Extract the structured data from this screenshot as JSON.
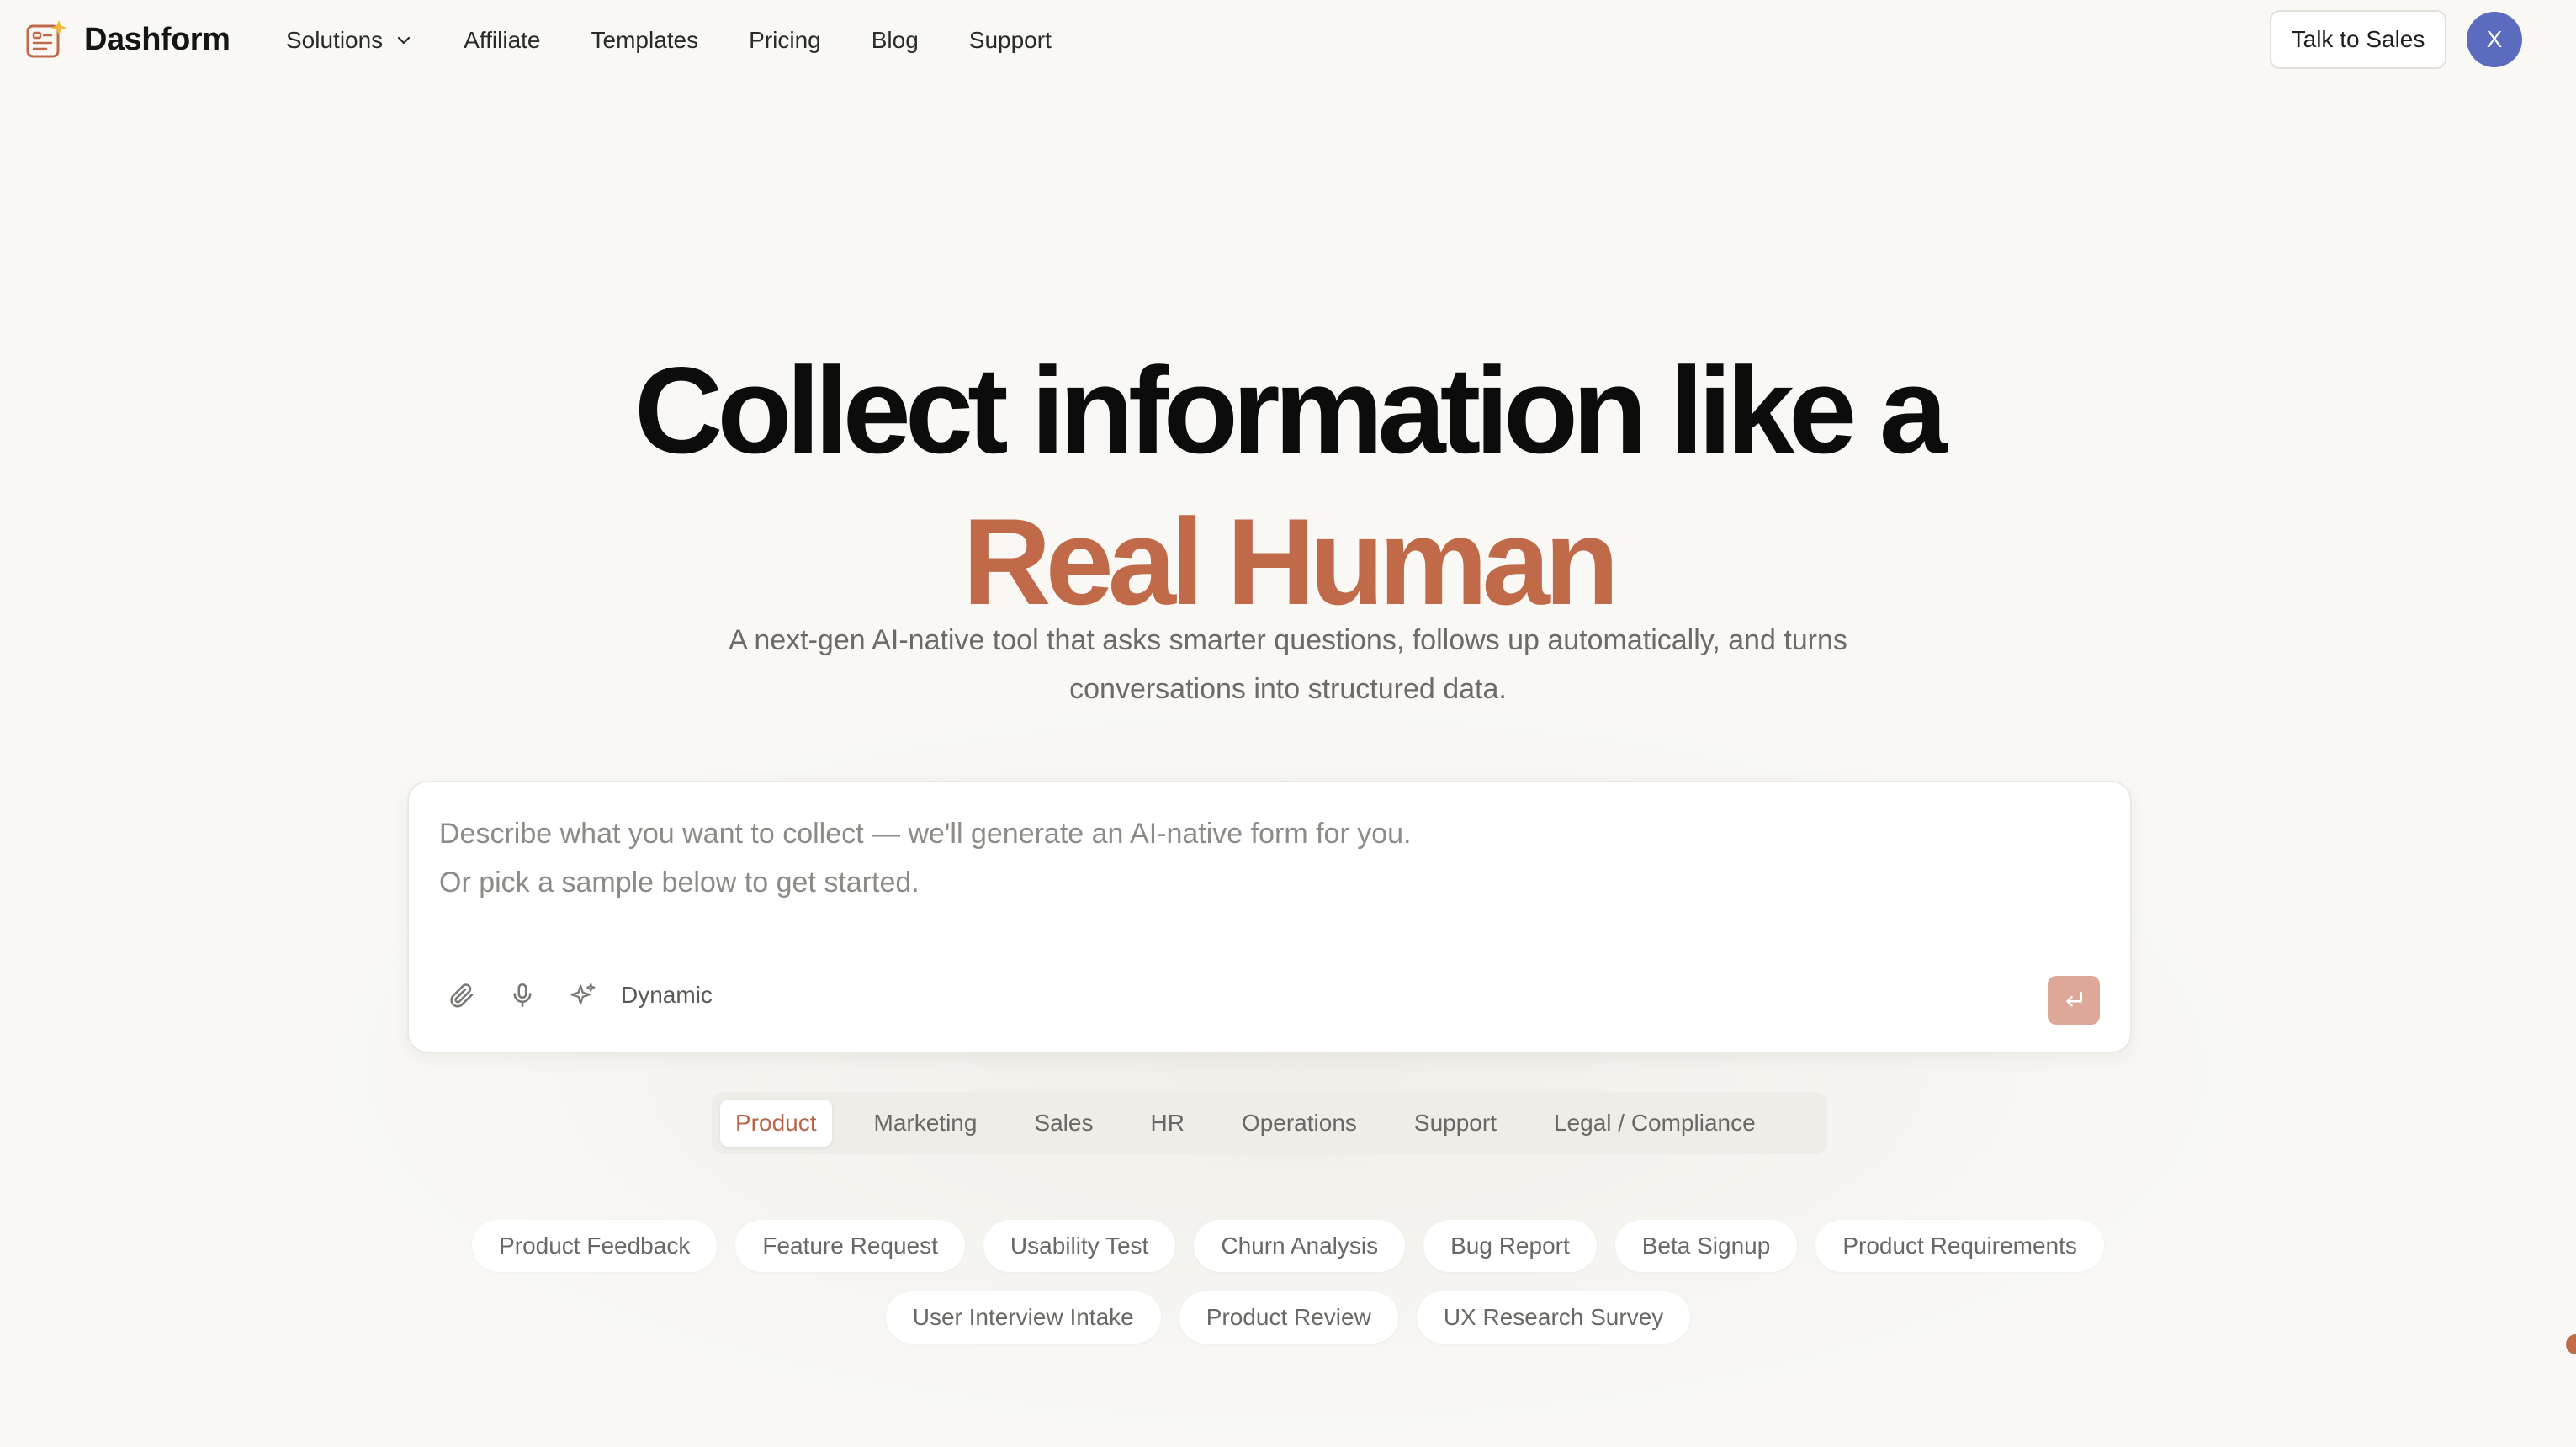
{
  "brand": {
    "name": "Dashform",
    "icon": "form-sparkle-icon",
    "accent_color": "#c06a4a"
  },
  "nav": {
    "items": [
      {
        "label": "Solutions",
        "has_dropdown": true
      },
      {
        "label": "Affiliate"
      },
      {
        "label": "Templates"
      },
      {
        "label": "Pricing"
      },
      {
        "label": "Blog"
      },
      {
        "label": "Support"
      }
    ]
  },
  "header": {
    "cta_label": "Talk to Sales",
    "avatar_initial": "X",
    "avatar_color": "#5b6bbd"
  },
  "hero": {
    "title_line1": "Collect information like a",
    "title_line2": "Real Human",
    "subtitle_line1": "A next-gen AI-native tool that asks smarter questions, follows up automatically, and turns",
    "subtitle_line2": "conversations into structured data."
  },
  "prompt": {
    "placeholder_line1": "Describe what you want to collect — we'll generate an AI-native form for you.",
    "placeholder_line2": "Or pick a sample below to get started.",
    "tools": [
      "paperclip-icon",
      "microphone-icon",
      "sparkles-icon"
    ],
    "mode_label": "Dynamic",
    "send_icon": "enter-arrow-icon",
    "send_color": "#dda898"
  },
  "categories": {
    "tabs": [
      "Product",
      "Marketing",
      "Sales",
      "HR",
      "Operations",
      "Support",
      "Legal / Compliance"
    ],
    "active": "Product"
  },
  "samples": {
    "row1": [
      "Product Feedback",
      "Feature Request",
      "Usability Test",
      "Churn Analysis",
      "Bug Report",
      "Beta Signup",
      "Product Requirements"
    ],
    "row2": [
      "User Interview Intake",
      "Product Review",
      "UX Research Survey"
    ]
  }
}
